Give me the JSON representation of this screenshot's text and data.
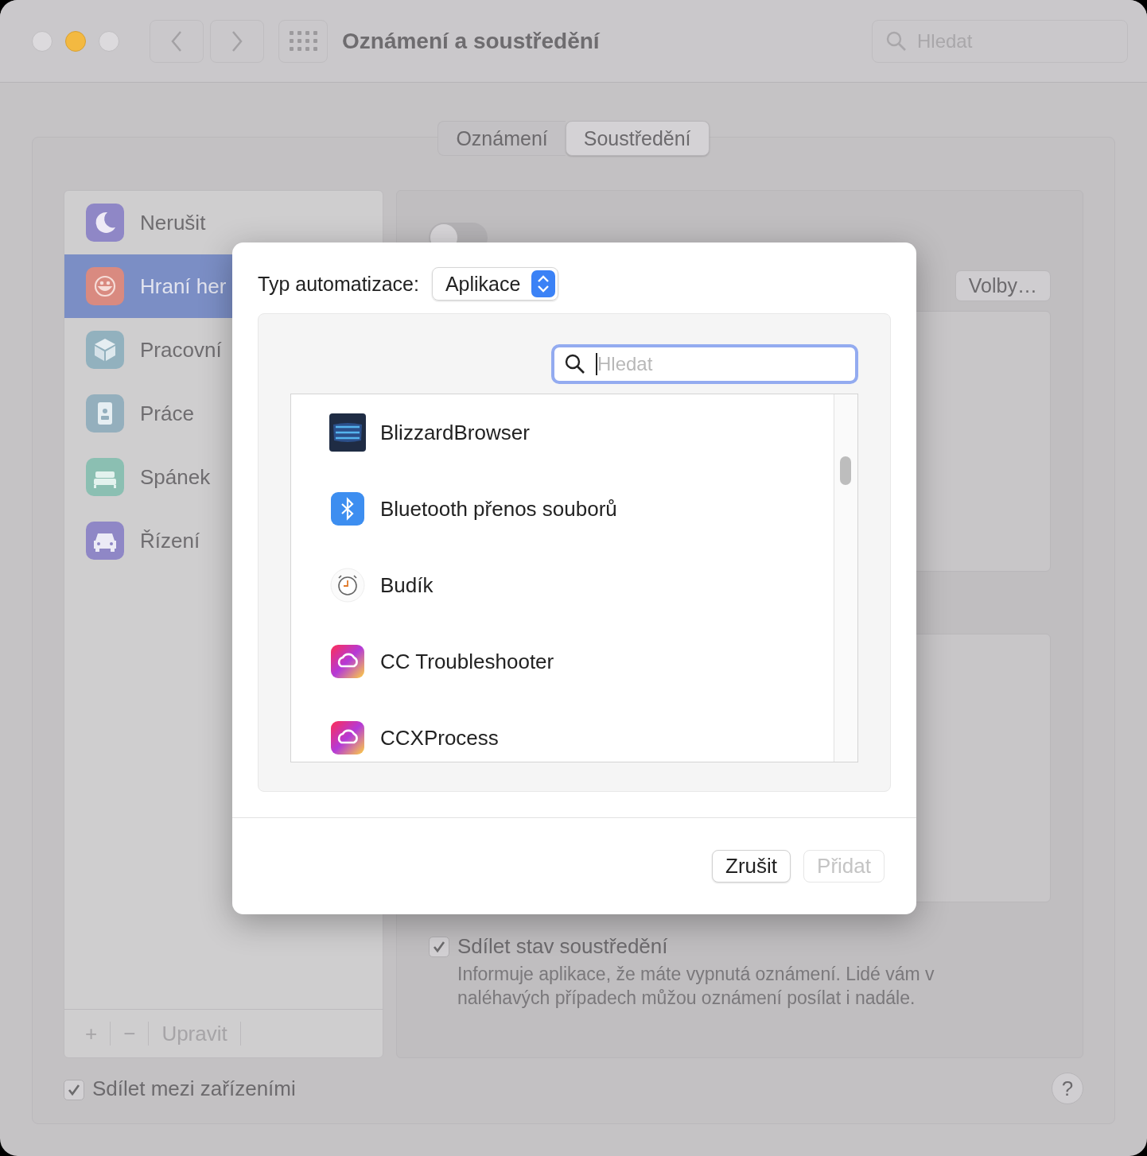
{
  "window": {
    "title": "Oznámení a soustředění",
    "search": {
      "placeholder": "Hledat"
    }
  },
  "tabs": [
    {
      "label": "Oznámení",
      "selected": false
    },
    {
      "label": "Soustředění",
      "selected": true
    }
  ],
  "focus_modes": [
    {
      "label": "Nerušit",
      "kind": "moon",
      "color": "#8f87c6",
      "selected": false
    },
    {
      "label": "Hraní her",
      "kind": "smiley",
      "color": "#d98a80",
      "selected": true
    },
    {
      "label": "Pracovní",
      "kind": "cube",
      "color": "#92b1be",
      "selected": false
    },
    {
      "label": "Práce",
      "kind": "badge",
      "color": "#94afbd",
      "selected": false
    },
    {
      "label": "Spánek",
      "kind": "bed",
      "color": "#8bbfb2",
      "selected": false
    },
    {
      "label": "Řízení",
      "kind": "car",
      "color": "#8f87c6",
      "selected": false
    }
  ],
  "list_toolbar": {
    "add": "+",
    "remove": "−",
    "edit": "Upravit"
  },
  "detail": {
    "toggle_on": false,
    "options_button": "Volby…",
    "share_status": {
      "label": "Sdílet stav soustředění",
      "checked": true,
      "description": "Informuje aplikace, že máte vypnutá oznámení. Lidé vám v naléhavých případech můžou oznámení posílat i nadále."
    }
  },
  "share_across_devices": {
    "label": "Sdílet mezi zařízeními",
    "checked": true
  },
  "help_button": "?",
  "dialog": {
    "type_label": "Typ automatizace:",
    "type_value": "Aplikace",
    "search": {
      "placeholder": "Hledat"
    },
    "apps": [
      {
        "name": "BlizzardBrowser",
        "kind": "blizzard"
      },
      {
        "name": "Bluetooth přenos souborů",
        "kind": "bluetooth"
      },
      {
        "name": "Budík",
        "kind": "clock"
      },
      {
        "name": "CC Troubleshooter",
        "kind": "cc"
      },
      {
        "name": "CCXProcess",
        "kind": "cc"
      }
    ],
    "buttons": [
      {
        "label": "Zrušit",
        "disabled": false
      },
      {
        "label": "Přidat",
        "disabled": true
      }
    ]
  }
}
